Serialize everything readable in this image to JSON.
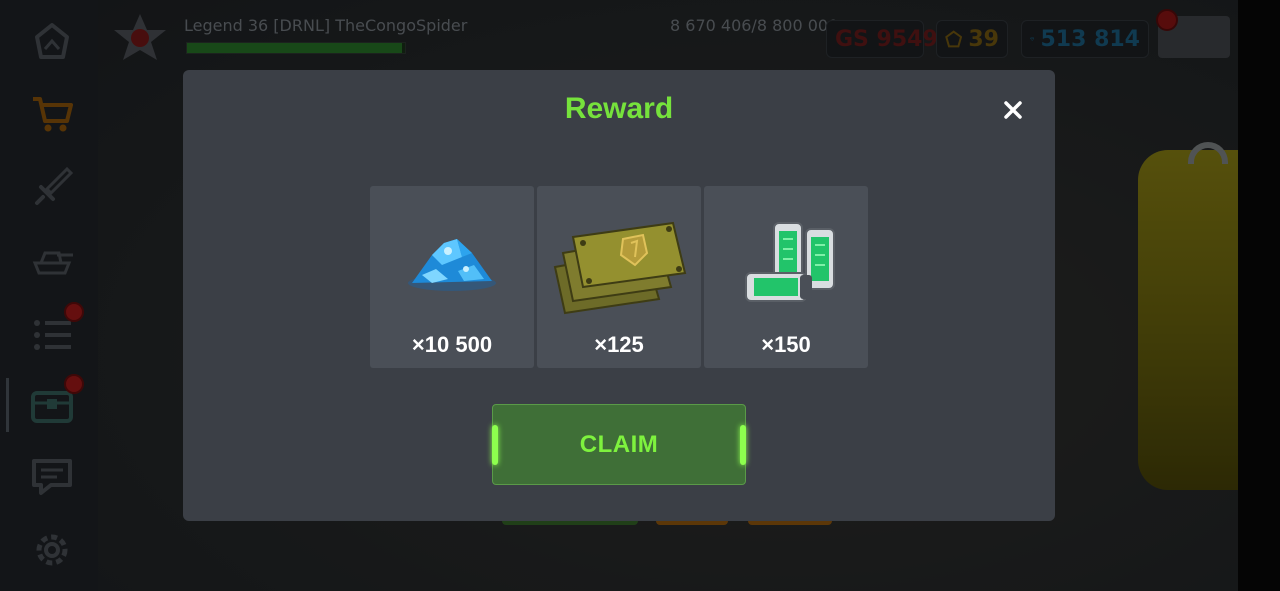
{
  "hud": {
    "player_name": "Legend 36  [DRNL] TheCongoSpider",
    "xp_text": "8 670 406/8 800 000",
    "xp_progress": 0.985,
    "gear_score": "GS 9549",
    "rank_points": "39",
    "gems": "513 814"
  },
  "sidebar": {
    "items": [
      {
        "icon": "crown-icon",
        "color": "#5a6068"
      },
      {
        "icon": "shopping-cart-icon",
        "color": "#a8650c"
      },
      {
        "icon": "sword-icon",
        "color": "#5a6068"
      },
      {
        "icon": "tank-icon",
        "color": "#5a6068"
      },
      {
        "icon": "tasks-icon",
        "color": "#5a6068"
      },
      {
        "icon": "chest-icon",
        "color": "#3f6f6a"
      },
      {
        "icon": "chat-icon",
        "color": "#5a6068"
      },
      {
        "icon": "gear-icon",
        "color": "#5a6068"
      }
    ]
  },
  "modal": {
    "title": "Reward",
    "rewards": [
      {
        "icon": "gems-pile-icon",
        "amount": "×10 500"
      },
      {
        "icon": "armor-plates-icon",
        "amount": "×125"
      },
      {
        "icon": "battery-cells-icon",
        "amount": "×150"
      }
    ],
    "claim_label": "CLAIM"
  },
  "colors": {
    "title": "#76e23c",
    "claim_text": "#7ef23e",
    "claim_bg": "#3f6f37",
    "modal_bg": "#3b3f46",
    "card_bg": "#4a4f57"
  }
}
